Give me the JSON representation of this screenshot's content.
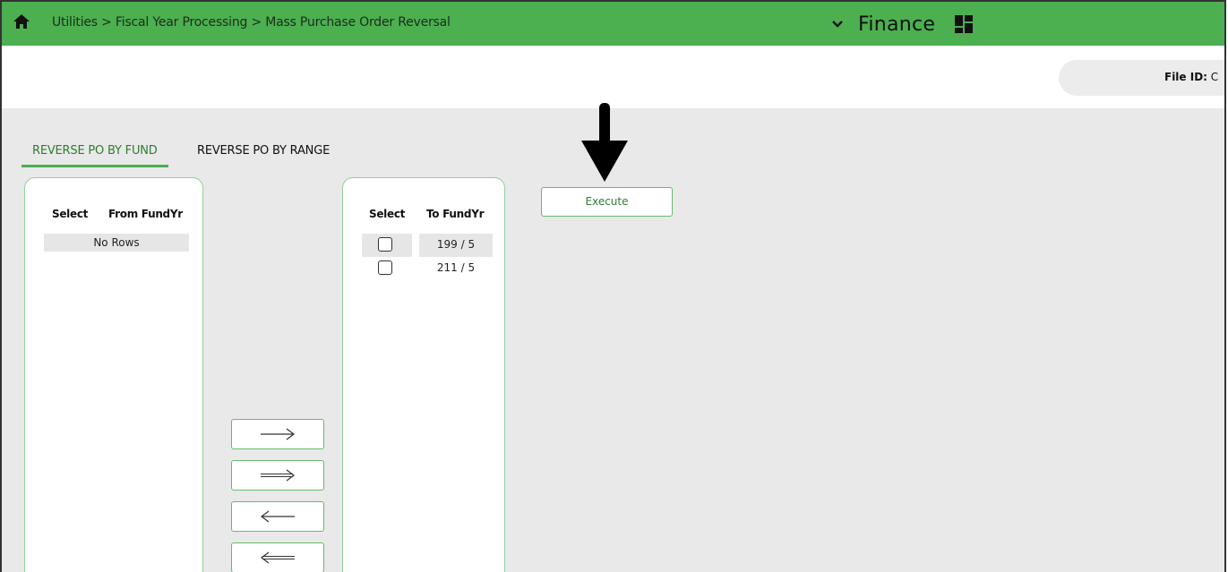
{
  "header": {
    "breadcrumb": "Utilities > Fiscal Year Processing > Mass Purchase Order Reversal",
    "module": "Finance",
    "home_icon": "home-icon",
    "chevron_icon": "chevron-down-icon",
    "apps_icon": "apps-grid-icon",
    "bar_color": "#4caf50"
  },
  "subheader": {
    "file_id_label": "File ID:",
    "file_id_value": "C"
  },
  "tabs": [
    {
      "label": "REVERSE PO BY FUND",
      "active": true
    },
    {
      "label": "REVERSE PO BY RANGE",
      "active": false
    }
  ],
  "from_panel": {
    "col_select": "Select",
    "col_fund": "From FundYr",
    "empty_text": "No Rows"
  },
  "to_panel": {
    "col_select": "Select",
    "col_fund": "To FundYr",
    "rows": [
      {
        "value": "199 / 5",
        "checked": false
      },
      {
        "value": "211 / 5",
        "checked": false
      }
    ]
  },
  "transfer_buttons": [
    {
      "name": "move-selected-right-button",
      "icon": "arrow-right-icon"
    },
    {
      "name": "move-all-right-button",
      "icon": "double-arrow-right-icon"
    },
    {
      "name": "move-selected-left-button",
      "icon": "arrow-left-icon"
    },
    {
      "name": "move-all-left-button",
      "icon": "double-arrow-left-icon"
    }
  ],
  "execute": {
    "label": "Execute"
  },
  "accent_color": "#2e7d32"
}
